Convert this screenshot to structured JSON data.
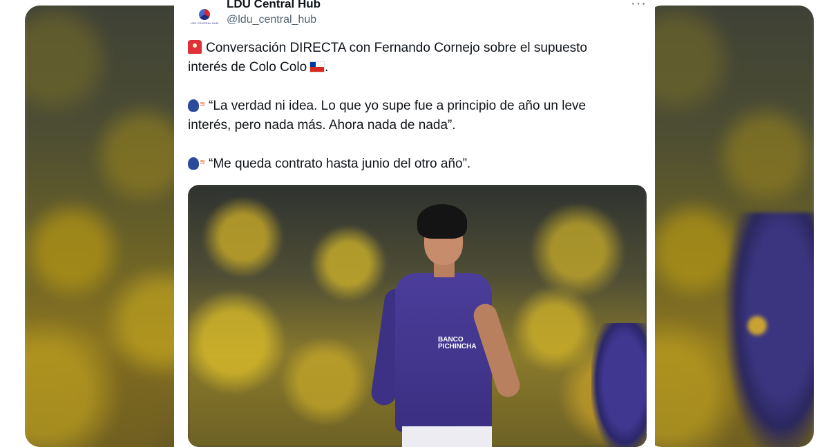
{
  "tweet": {
    "display_name": "LDU Central Hub",
    "handle": "@ldu_central_hub",
    "avatar_text": "LDU CENTRAL HUB",
    "more_label": "···",
    "paragraphs": [
      "Conversación DIRECTA con Fernando Cornejo sobre el supuesto interés de Colo Colo",
      "“La verdad ni idea. Lo que yo supe fue a principio de año un leve interés, pero nada más. Ahora nada de nada”.",
      "“Me queda contrato hasta junio del otro año”."
    ],
    "paragraph_end": ".",
    "icons": [
      "siren-icon",
      "chile-flag-icon",
      "speaking-head-icon"
    ]
  },
  "photo": {
    "jersey_sponsor": "BANCO PICHINCHA"
  },
  "colors": {
    "text": "#0f1419",
    "secondary_text": "#536471",
    "jersey": "#3a2f82"
  }
}
